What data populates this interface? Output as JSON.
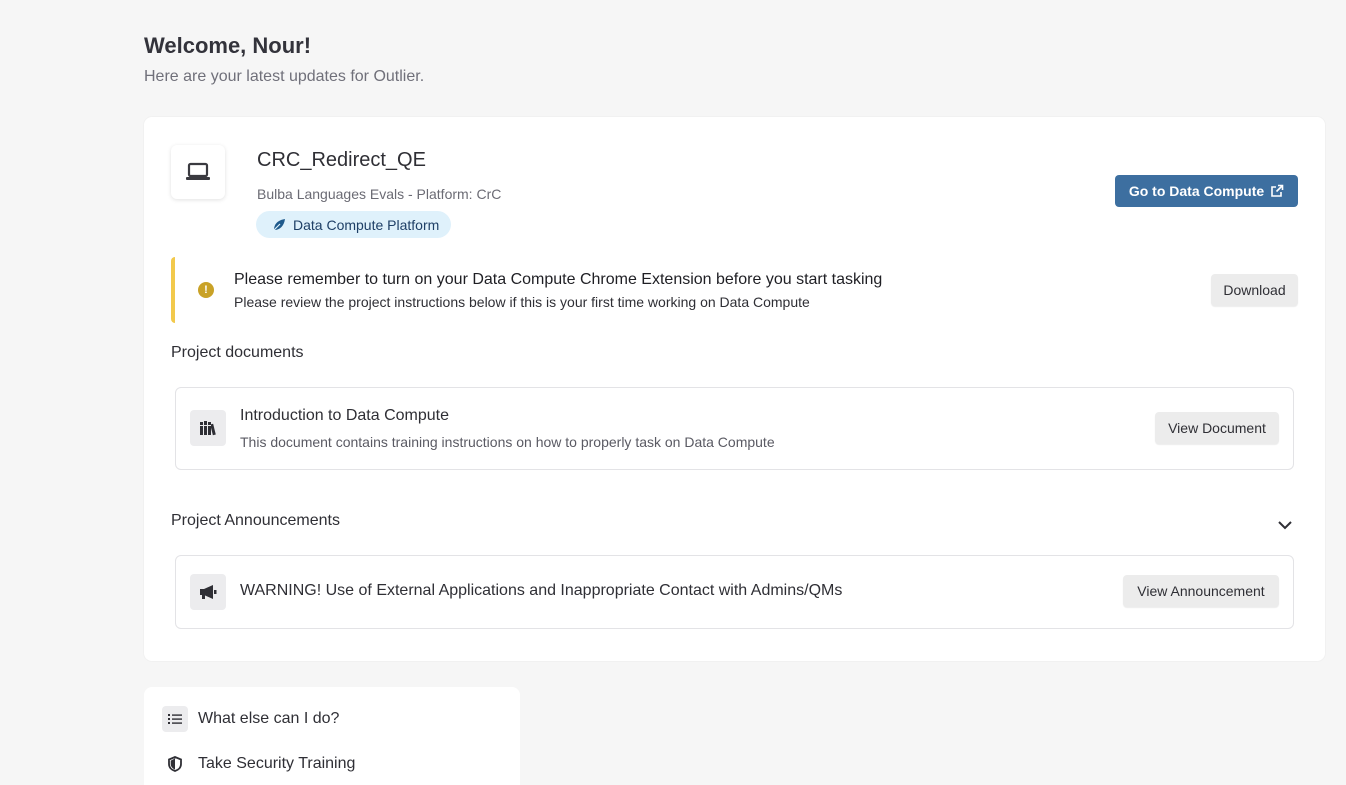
{
  "header": {
    "title": "Welcome, Nour!",
    "subtitle": "Here are your latest updates for Outlier."
  },
  "project": {
    "name": "CRC_Redirect_QE",
    "meta": "Bulba Languages Evals - Platform: CrC",
    "platform_tag": "Data Compute Platform",
    "go_button_label": "Go to Data Compute",
    "icon": "laptop-icon"
  },
  "alert": {
    "title": "Please remember to turn on your Data Compute Chrome Extension before you start tasking",
    "text": "Please review the project instructions below if this is your first time working on Data Compute",
    "button_label": "Download",
    "accent_color": "#f2c94c",
    "icon": "exclamation-icon"
  },
  "documents": {
    "heading": "Project documents",
    "items": [
      {
        "title": "Introduction to Data Compute",
        "description": "This document contains training instructions on how to properly task on Data Compute",
        "button_label": "View Document",
        "icon": "books-icon"
      }
    ]
  },
  "announcements": {
    "heading": "Project Announcements",
    "expanded": true,
    "items": [
      {
        "title": "WARNING! Use of External Applications and Inappropriate Contact with Admins/QMs",
        "button_label": "View Announcement",
        "icon": "megaphone-icon"
      }
    ]
  },
  "else": {
    "heading": "What else can I do?",
    "items": [
      {
        "label": "Take Security Training",
        "icon": "shield-icon"
      }
    ]
  },
  "colors": {
    "primary_button": "#3d6fa0",
    "tag_background": "#dff1fb",
    "page_background": "#f6f6f6"
  }
}
